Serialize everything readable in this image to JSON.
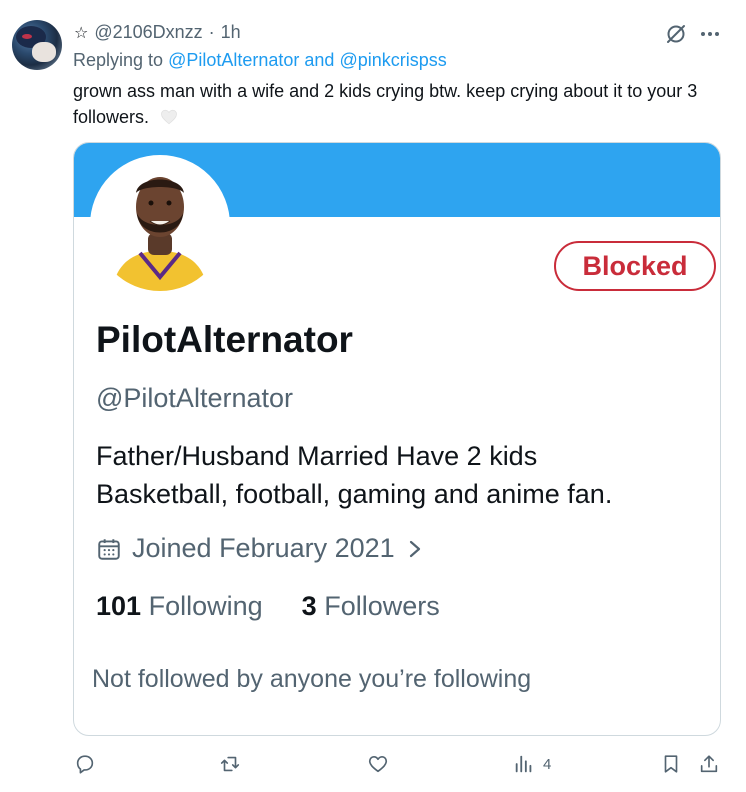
{
  "tweet": {
    "author_handle": "@2106Dxnzz",
    "separator": "·",
    "time": "1h",
    "replying_prefix": "Replying to",
    "replying_to": "@PilotAlternator and @pinkcrispss",
    "text": "grown ass man with a wife and 2 kids crying btw. keep crying  about it to your 3 followers."
  },
  "card": {
    "button_label": "Blocked",
    "name": "PilotAlternator",
    "handle": "@PilotAlternator",
    "bio_line1": "Father/Husband Married Have 2 kids",
    "bio_line2": "Basketball, football, gaming and anime fan.",
    "joined": "Joined February 2021",
    "following_count": "101",
    "following_label": "Following",
    "followers_count": "3",
    "followers_label": "Followers",
    "not_followed": "Not followed by anyone you’re following"
  },
  "actions": {
    "views": "4"
  },
  "colors": {
    "accent": "#1d9bf0",
    "banner": "#2ea4f0",
    "blocked": "#c92c3a",
    "muted_text": "#536471"
  },
  "icons": [
    "star-icon",
    "grok-icon",
    "more-icon",
    "heart-emoji-icon",
    "calendar-icon",
    "chevron-right-icon",
    "reply-icon",
    "retweet-icon",
    "like-icon",
    "views-icon",
    "bookmark-icon",
    "share-icon"
  ]
}
